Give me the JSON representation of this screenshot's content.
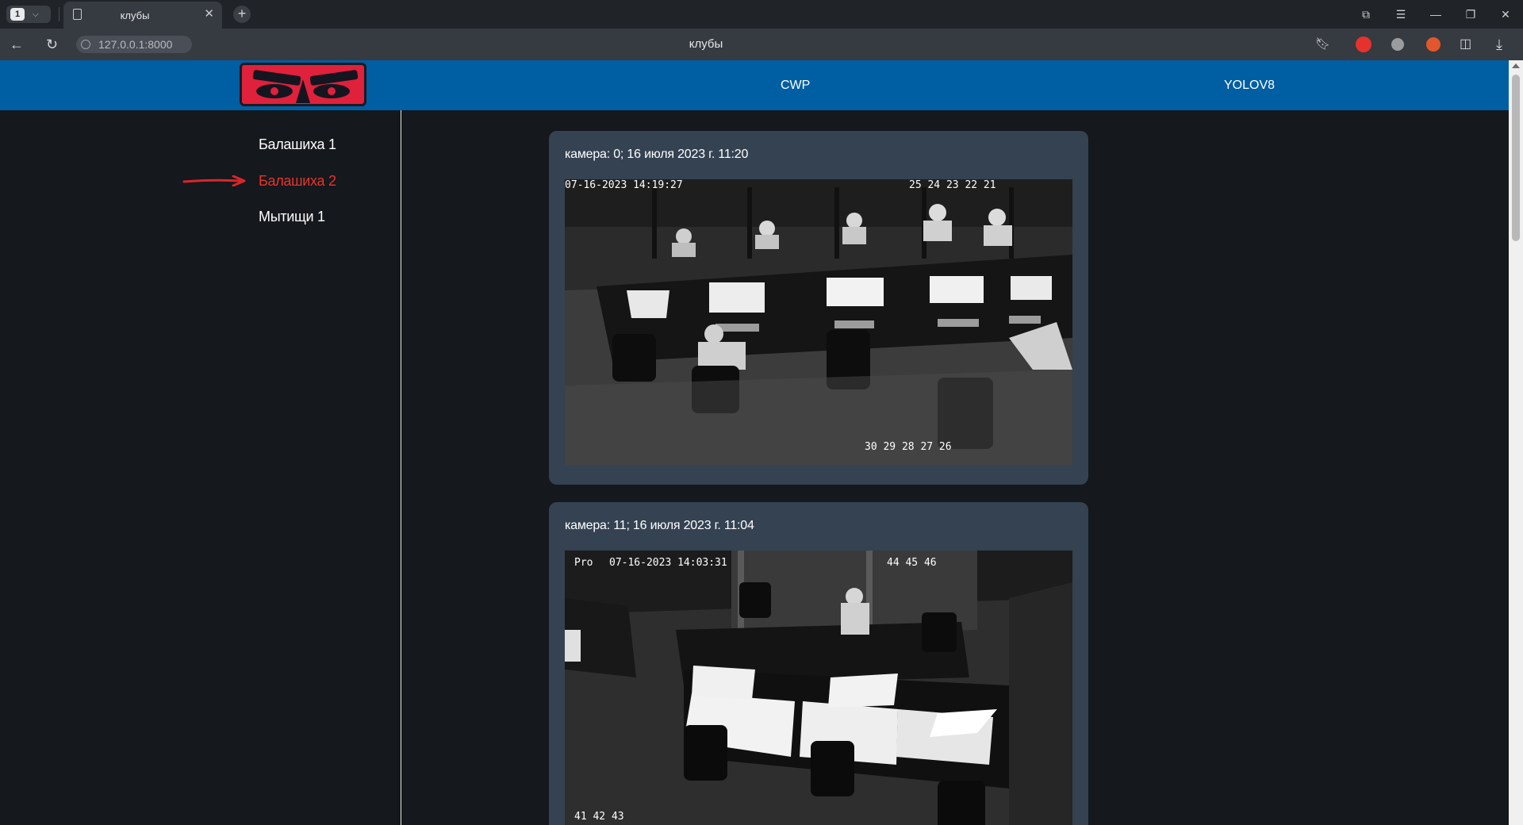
{
  "browser": {
    "tab_count": "1",
    "tab_title": "клубы",
    "url": "127.0.0.1:8000",
    "page_title": "клубы"
  },
  "header": {
    "nav": [
      "CWP",
      "YOLOV8"
    ],
    "color": "#005ea2"
  },
  "sidebar": {
    "items": [
      {
        "label": "Балашиха 1",
        "active": false
      },
      {
        "label": "Балашиха 2",
        "active": true
      },
      {
        "label": "Мытищи 1",
        "active": false
      }
    ],
    "active_color": "#e8332a"
  },
  "cameras": [
    {
      "caption": "камера: 0; 16 июля 2023 г. 11:20",
      "timestamp": "07-16-2023 14:19:27",
      "seats_top": "25 24 23 22 21",
      "seats_bottom": "30 29 28 27 26"
    },
    {
      "caption": "камера: 11; 16 июля 2023 г. 11:04",
      "osd_prefix": "Pro",
      "timestamp": "07-16-2023 14:03:31",
      "seats_top": "44 45 46",
      "seats_bottom": "41 42 43"
    }
  ]
}
